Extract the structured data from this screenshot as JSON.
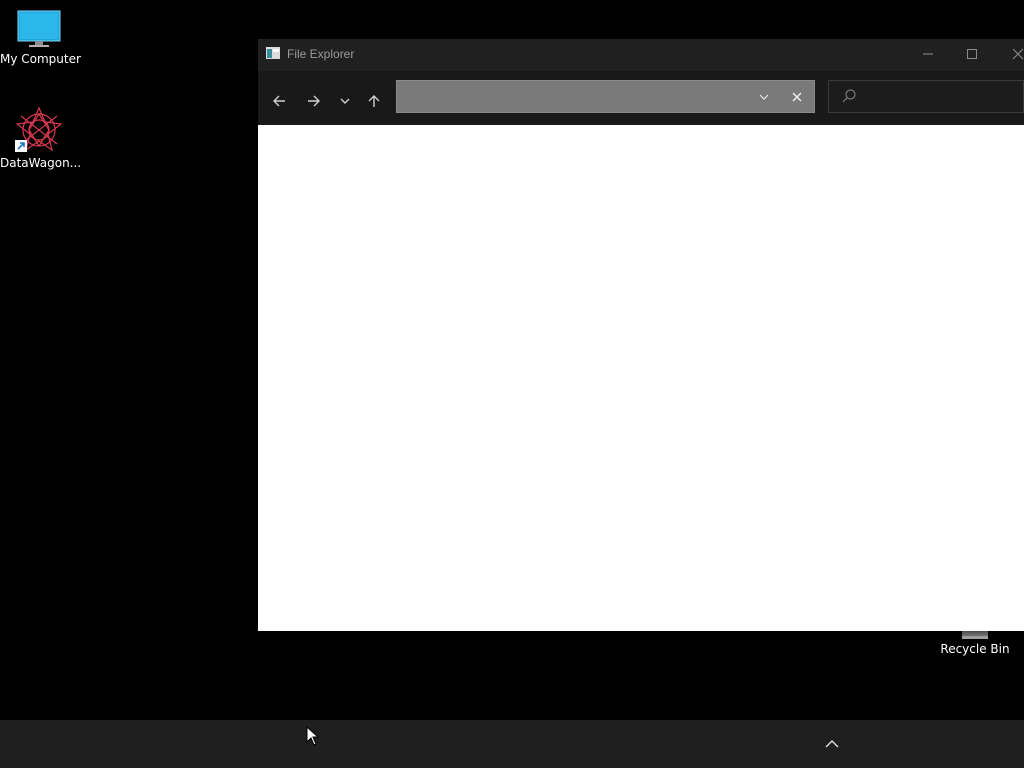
{
  "desktop": {
    "icons": [
      {
        "label": "My Computer",
        "icon": "monitor-icon"
      },
      {
        "label": "DataWagon...",
        "icon": "datawagon-app-icon",
        "shortcut": true
      },
      {
        "label": "Recycle Bin",
        "icon": "recycle-bin-icon"
      }
    ]
  },
  "window": {
    "title": "File Explorer",
    "title_icon": "file-explorer-icon",
    "controls": {
      "minimize": "minimize-icon",
      "maximize": "maximize-icon",
      "close": "close-icon"
    },
    "nav": {
      "back": "arrow-left-icon",
      "forward": "arrow-right-icon",
      "recent": "chevron-down-icon",
      "up": "arrow-up-icon"
    },
    "address": {
      "value": "",
      "placeholder": ""
    },
    "search": {
      "value": "",
      "placeholder": ""
    }
  },
  "taskbar": {
    "tray_chevron": "chevron-up-icon"
  },
  "colors": {
    "desktop_bg": "#000000",
    "window_chrome": "#202020",
    "navbar_bg": "#191919",
    "address_bg": "#7a7a7a",
    "content_bg": "#ffffff",
    "taskbar_bg": "#1f1f1f"
  }
}
